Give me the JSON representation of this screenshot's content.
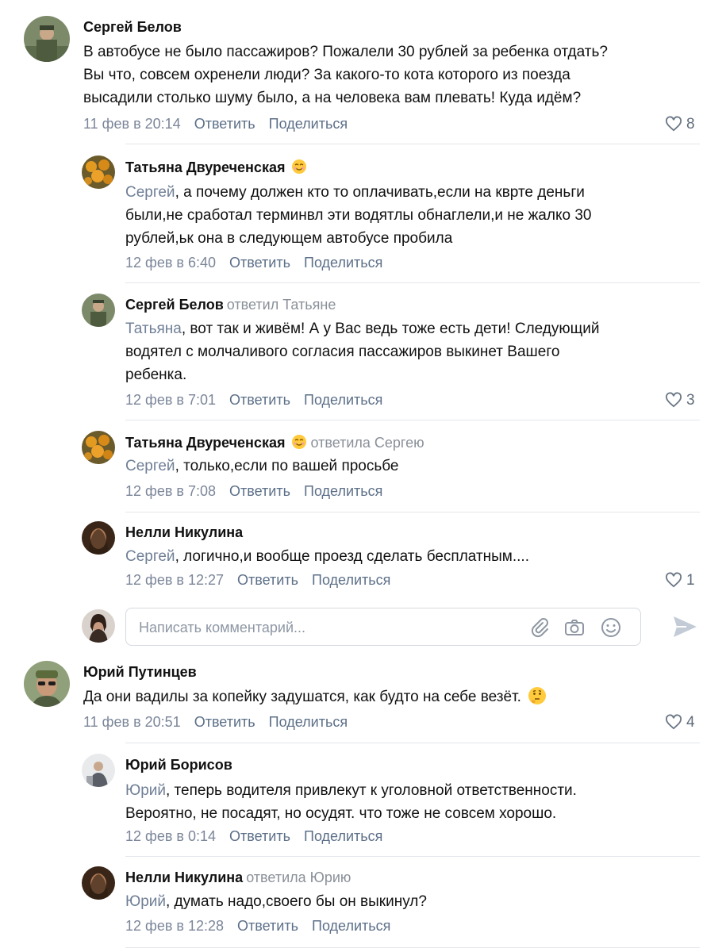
{
  "comments": [
    {
      "author": "Сергей Белов",
      "lines": [
        "В автобусе не было пассажиров? Пожалели 30 рублей за ребенка отдать?",
        "Вы что, совсем охренели люди? За какого-то кота которого из поезда",
        "высадили столько шуму было, а на человека вам плевать! Куда идём?"
      ],
      "date": "11 фев в 20:14",
      "reply_label": "Ответить",
      "share_label": "Поделиться",
      "likes": "8"
    },
    {
      "author": "Татьяна Двуреченская",
      "addressee": "Сергей",
      "lines": [
        ", а почему должен кто то оплачивать,если на кврте деньги",
        "были,не сработал терминвл эти водятлы обнаглели,и не жалко 30",
        "рублей,ьк она в следующем автобусе пробила"
      ],
      "date": "12 фев в 6:40",
      "reply_label": "Ответить",
      "share_label": "Поделиться"
    },
    {
      "author": "Сергей Белов",
      "reply_to": "ответил Татьяне",
      "addressee": "Татьяна",
      "lines": [
        ", вот так и живём! А у Вас ведь тоже есть дети! Следующий",
        "водятел с молчаливого согласия пассажиров выкинет Вашего",
        "ребенка."
      ],
      "date": "12 фев в 7:01",
      "reply_label": "Ответить",
      "share_label": "Поделиться",
      "likes": "3"
    },
    {
      "author": "Татьяна Двуреченская",
      "reply_to": "ответила Сергею",
      "addressee": "Сергей",
      "lines": [
        ", только,если по вашей просьбе"
      ],
      "date": "12 фев в 7:08",
      "reply_label": "Ответить",
      "share_label": "Поделиться"
    },
    {
      "author": "Нелли Никулина",
      "addressee": "Сергей",
      "lines": [
        ", логично,и вообще проезд сделать бесплатным...."
      ],
      "date": "12 фев в 12:27",
      "reply_label": "Ответить",
      "share_label": "Поделиться",
      "likes": "1"
    },
    {
      "author": "Юрий Путинцев",
      "lines": [
        "Да они вадилы за копейку задушатся, как будто на себе везёт."
      ],
      "date": "11 фев в 20:51",
      "reply_label": "Ответить",
      "share_label": "Поделиться",
      "likes": "4"
    },
    {
      "author": "Юрий Борисов",
      "addressee": "Юрий",
      "lines": [
        ", теперь водителя привлекут к уголовной ответственности.",
        "Вероятно, не посадят, но осудят. что тоже не совсем хорошо."
      ],
      "date": "12 фев в 0:14",
      "reply_label": "Ответить",
      "share_label": "Поделиться"
    },
    {
      "author": "Нелли Никулина",
      "reply_to": "ответила Юрию",
      "addressee": "Юрий",
      "lines": [
        ", думать надо,своего бы он выкинул?"
      ],
      "date": "12 фев в 12:28",
      "reply_label": "Ответить",
      "share_label": "Поделиться"
    }
  ],
  "compose": {
    "placeholder": "Написать комментарий..."
  },
  "colors": {
    "link": "#5c6f88",
    "meta": "#7b8699",
    "separator": "#e3e6ea"
  },
  "icons": [
    "heart-icon",
    "paperclip-icon",
    "camera-icon",
    "smile-icon",
    "send-icon"
  ]
}
